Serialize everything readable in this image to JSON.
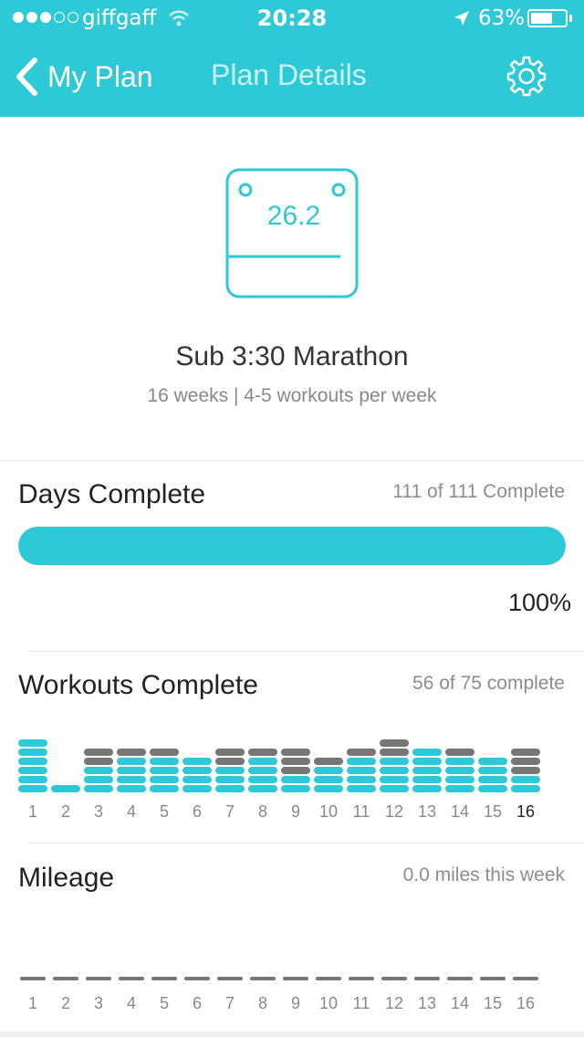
{
  "status_bar": {
    "signal_full": 3,
    "signal_total": 5,
    "carrier": "giffgaff",
    "time": "20:28",
    "battery_percent_label": "63%",
    "battery_level": 0.63
  },
  "nav": {
    "back_label": "My Plan",
    "title": "Plan Details",
    "settings_icon": "gear-icon"
  },
  "plan": {
    "icon_label": "26.2",
    "name": "Sub 3:30 Marathon",
    "subtitle": "16 weeks | 4-5 workouts per week"
  },
  "days_complete": {
    "title": "Days Complete",
    "summary": "111 of 111 Complete",
    "progress": 1.0,
    "percent_label": "100%"
  },
  "workouts_complete": {
    "title": "Workouts Complete",
    "summary": "56 of 75 complete",
    "current_week": 16,
    "weeks": [
      {
        "label": "1",
        "done": 6,
        "missed": 0
      },
      {
        "label": "2",
        "done": 1,
        "missed": 0
      },
      {
        "label": "3",
        "done": 3,
        "missed": 2
      },
      {
        "label": "4",
        "done": 4,
        "missed": 1
      },
      {
        "label": "5",
        "done": 4,
        "missed": 1
      },
      {
        "label": "6",
        "done": 4,
        "missed": 0
      },
      {
        "label": "7",
        "done": 3,
        "missed": 2
      },
      {
        "label": "8",
        "done": 4,
        "missed": 1
      },
      {
        "label": "9",
        "done": 2,
        "missed": 3
      },
      {
        "label": "10",
        "done": 3,
        "missed": 1
      },
      {
        "label": "11",
        "done": 4,
        "missed": 1
      },
      {
        "label": "12",
        "done": 4,
        "missed": 2
      },
      {
        "label": "13",
        "done": 5,
        "missed": 0
      },
      {
        "label": "14",
        "done": 4,
        "missed": 1
      },
      {
        "label": "15",
        "done": 4,
        "missed": 0
      },
      {
        "label": "16",
        "done": 2,
        "missed": 3
      }
    ],
    "colors": {
      "done": "#2ec9d6",
      "missed": "#767676"
    }
  },
  "mileage": {
    "title": "Mileage",
    "summary": "0.0 miles this week",
    "weeks": [
      "1",
      "2",
      "3",
      "4",
      "5",
      "6",
      "7",
      "8",
      "9",
      "10",
      "11",
      "12",
      "13",
      "14",
      "15",
      "16"
    ],
    "values": [
      0,
      0,
      0,
      0,
      0,
      0,
      0,
      0,
      0,
      0,
      0,
      0,
      0,
      0,
      0,
      0
    ]
  },
  "colors": {
    "accent": "#2ec9d6",
    "missed": "#767676"
  }
}
